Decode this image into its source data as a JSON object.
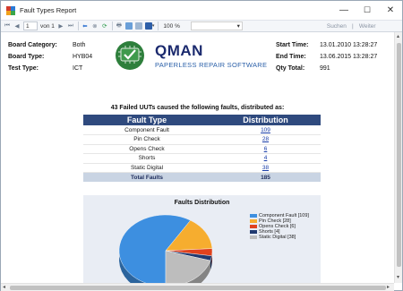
{
  "window": {
    "title": "Fault Types Report",
    "minimize": "—",
    "maximize": "☐",
    "close": "✕"
  },
  "toolbar": {
    "first": "⏮",
    "prev": "◀",
    "page_value": "1",
    "page_of": "von 1",
    "next": "▶",
    "last": "⏭",
    "back": "⬅",
    "stop": "⊗",
    "refresh": "⟳",
    "print": "🖶",
    "zoom_value": "100 %",
    "zoom_dropdown": "▾",
    "search_label": "Suchen",
    "separator": "|",
    "next_label": "Weiter"
  },
  "report": {
    "board_category_label": "Board Category:",
    "board_category": "Both",
    "board_type_label": "Board Type:",
    "board_type": "HYB04",
    "test_type_label": "Test Type:",
    "test_type": "ICT",
    "start_time_label": "Start Time:",
    "start_time": "13.01.2010 13:28:27",
    "end_time_label": "End Time:",
    "end_time": "13.06.2015 13:28:27",
    "qty_total_label": "Qty Total:",
    "qty_total": "991",
    "logo_title": "QMAN",
    "logo_subtitle": "PAPERLESS REPAIR SOFTWARE",
    "summary": "43 Failed UUTs caused the following faults, distributed as:",
    "table": {
      "col_type": "Fault Type",
      "col_dist": "Distribution",
      "rows": [
        {
          "type": "Component Fault",
          "count": "109"
        },
        {
          "type": "Pin Check",
          "count": "28"
        },
        {
          "type": "Opens Check",
          "count": "6"
        },
        {
          "type": "Shorts",
          "count": "4"
        },
        {
          "type": "Static Digital",
          "count": "38"
        }
      ],
      "total_label": "Total Faults",
      "total": "185"
    }
  },
  "chart_data": {
    "type": "pie",
    "title": "Faults Distribution",
    "categories": [
      "Component Fault",
      "Pin Check",
      "Opens Check",
      "Shorts",
      "Static Digital"
    ],
    "values": [
      109,
      28,
      6,
      4,
      38
    ],
    "legend": [
      "Component Fault [109]",
      "Pin Check [28]",
      "Opens Check [6]",
      "Shorts [4]",
      "Static Digital [38]"
    ],
    "colors": [
      "#3d8fe0",
      "#f6ad2f",
      "#e0421e",
      "#203a70",
      "#bdbdbd"
    ],
    "legend_position": "right"
  }
}
